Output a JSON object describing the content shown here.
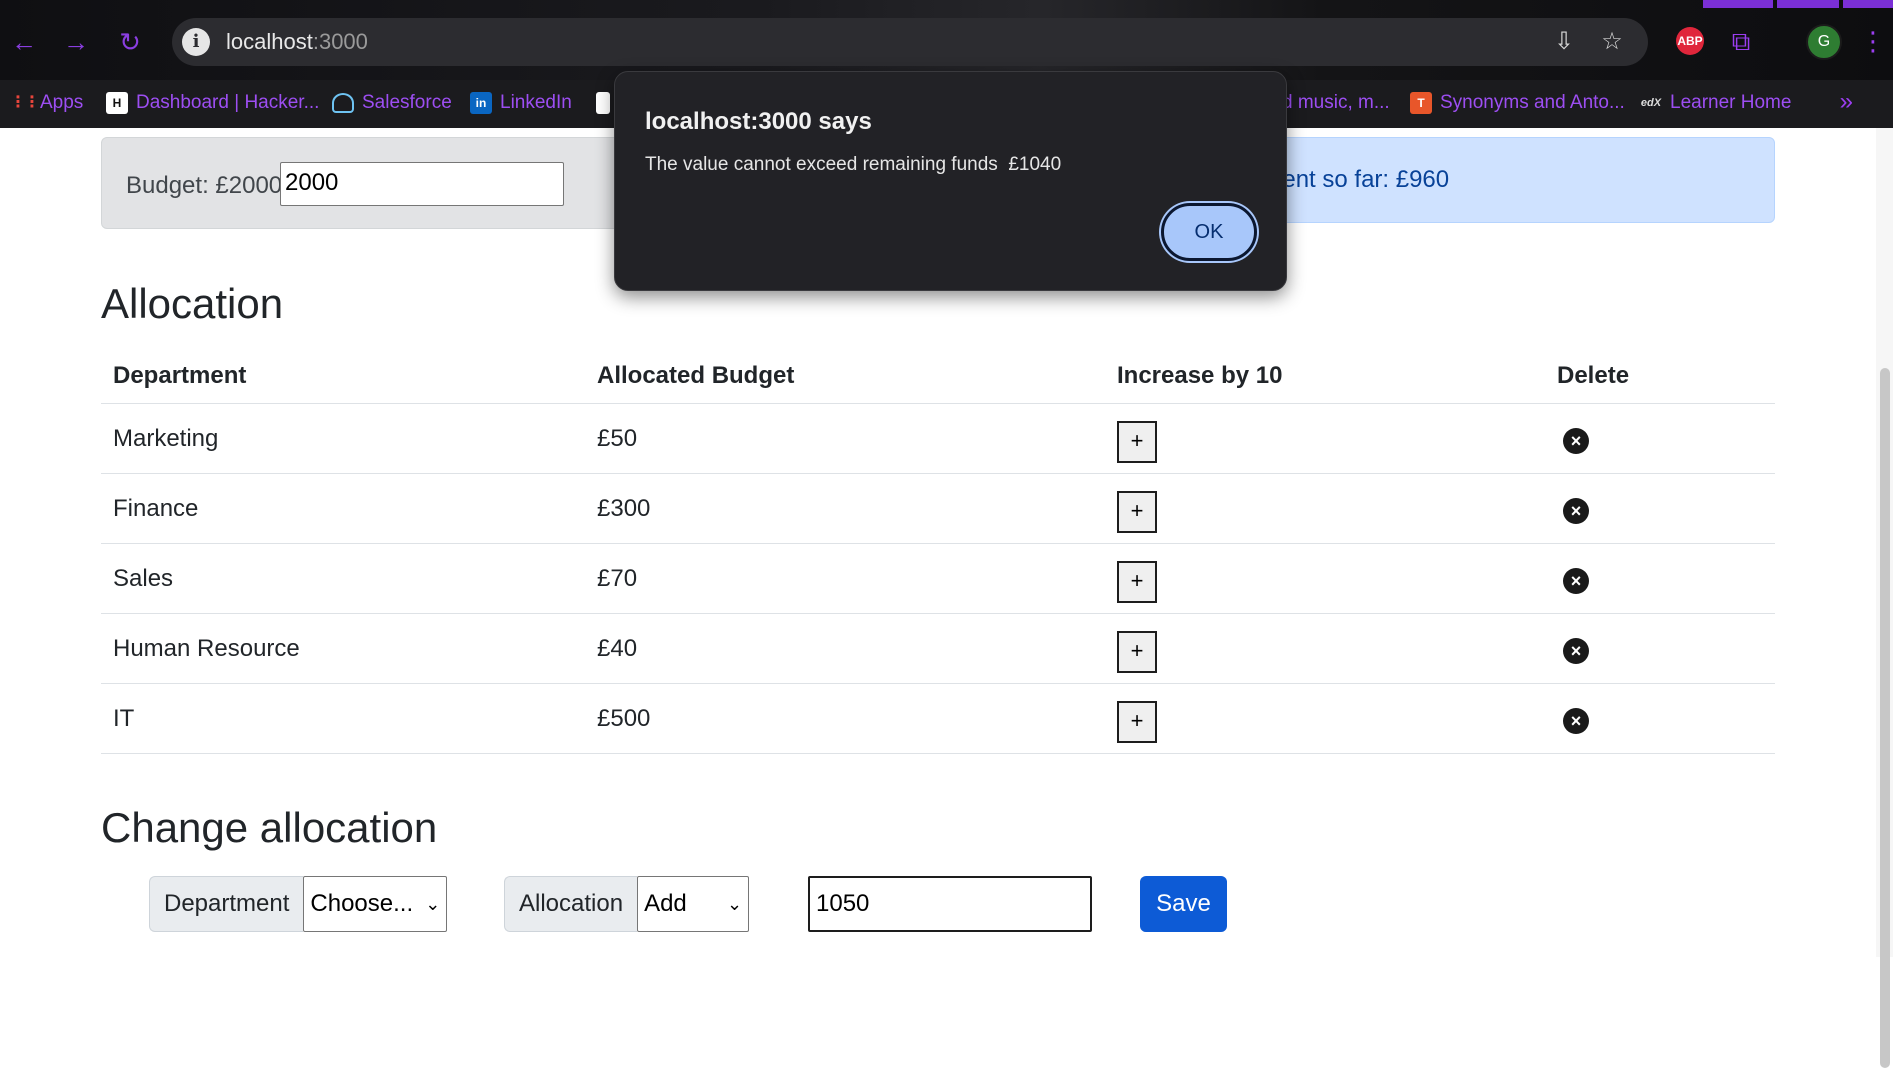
{
  "browser": {
    "url_host": "localhost",
    "url_port": ":3000",
    "bookmarks": [
      {
        "label": "Apps",
        "icon": "apps-grid-icon"
      },
      {
        "label": "Dashboard | Hacker...",
        "icon": "hackerrank-icon"
      },
      {
        "label": "Salesforce",
        "icon": "salesforce-icon"
      },
      {
        "label": "LinkedIn",
        "icon": "linkedin-icon"
      },
      {
        "label": "d music, m...",
        "icon": "music-icon"
      },
      {
        "label": "Synonyms and Anto...",
        "icon": "thesaurus-icon"
      },
      {
        "label": "Learner Home",
        "icon": "edx-icon"
      }
    ],
    "icons": {
      "back": "←",
      "forward": "→",
      "reload": "↻",
      "info": "i",
      "install": "⇩",
      "star": "☆",
      "abp": "ABP",
      "extensions": "⧉",
      "avatar": "G",
      "menu": "⋮",
      "more": "»",
      "apps_glyph": "⋮⋮",
      "hackerrank_glyph": "H",
      "linkedin_glyph": "in",
      "synonyms_glyph": "T",
      "edx_glyph": "edX"
    },
    "accent_color": "#9d4ef2"
  },
  "budget": {
    "label": "Budget: £2000",
    "input_value": "2000"
  },
  "spent": {
    "text": "pent so far: £960"
  },
  "allocation": {
    "title": "Allocation",
    "headers": [
      "Department",
      "Allocated Budget",
      "Increase by 10",
      "Delete"
    ],
    "rows": [
      {
        "department": "Marketing",
        "budget": "£50"
      },
      {
        "department": "Finance",
        "budget": "£300"
      },
      {
        "department": "Sales",
        "budget": "£70"
      },
      {
        "department": "Human Resource",
        "budget": "£40"
      },
      {
        "department": "IT",
        "budget": "£500"
      }
    ],
    "increase_label": "+",
    "delete_glyph": "×"
  },
  "change": {
    "title": "Change allocation",
    "department_label": "Department",
    "department_select": "Choose...",
    "allocation_label": "Allocation",
    "allocation_select": "Add",
    "amount_value": "1050",
    "save_label": "Save",
    "chevron": "⌄"
  },
  "dialog": {
    "title": "localhost:3000 says",
    "message": "The value cannot exceed remaining funds  £1040",
    "ok_label": "OK"
  }
}
